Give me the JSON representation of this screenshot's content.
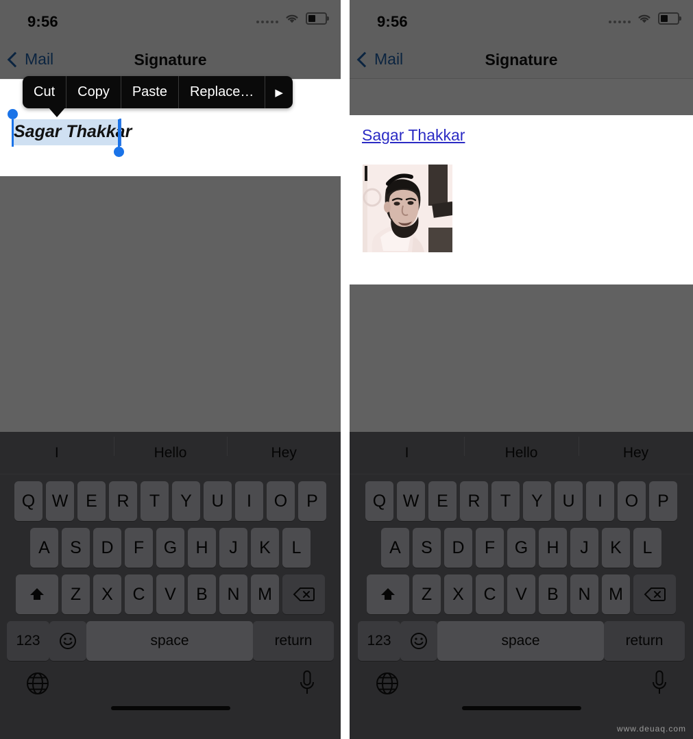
{
  "meta": {
    "watermark": "www.deuaq.com"
  },
  "colors": {
    "accent_blue": "#1f5fa8",
    "handle_blue": "#1a73e8",
    "selection_highlight": "#cfe0f2",
    "link_blue": "#2b2bc4",
    "dim_overlay": "#000000",
    "keyboard_bg": "#6e6e73",
    "key_bg": "#c9c9cf",
    "key_dark_bg": "#9a9aa0",
    "menu_bg": "#0a0a0a"
  },
  "status_bar": {
    "time": "9:56",
    "signal_icon": "signal-dots-icon",
    "wifi_icon": "wifi-icon",
    "battery_icon": "battery-icon",
    "battery_level_percent": 38
  },
  "nav_bar": {
    "back_label": "Mail",
    "back_icon": "chevron-left-icon",
    "title": "Signature"
  },
  "left_panel": {
    "edit_menu": {
      "items": [
        {
          "label": "Cut",
          "name": "cut"
        },
        {
          "label": "Copy",
          "name": "copy"
        },
        {
          "label": "Paste",
          "name": "paste"
        },
        {
          "label": "Replace…",
          "name": "replace"
        },
        {
          "label": "▶",
          "name": "more-arrow"
        }
      ]
    },
    "signature": {
      "text": "Sagar Thakkar",
      "selected": true,
      "style": "bold-italic"
    }
  },
  "right_panel": {
    "signature": {
      "link_text": "Sagar Thakkar",
      "image_alt": "profile-photo"
    }
  },
  "keyboard": {
    "predictions": [
      "I",
      "Hello",
      "Hey"
    ],
    "row1": [
      "Q",
      "W",
      "E",
      "R",
      "T",
      "Y",
      "U",
      "I",
      "O",
      "P"
    ],
    "row2": [
      "A",
      "S",
      "D",
      "F",
      "G",
      "H",
      "J",
      "K",
      "L"
    ],
    "row3": [
      "Z",
      "X",
      "C",
      "V",
      "B",
      "N",
      "M"
    ],
    "shift_icon": "shift-up-arrow-icon",
    "backspace_icon": "backspace-delete-icon",
    "numbers_label": "123",
    "emoji_icon": "emoji-smiley-icon",
    "space_label": "space",
    "return_label": "return",
    "globe_icon": "globe-language-icon",
    "mic_icon": "microphone-icon",
    "home_indicator": "home-indicator"
  }
}
